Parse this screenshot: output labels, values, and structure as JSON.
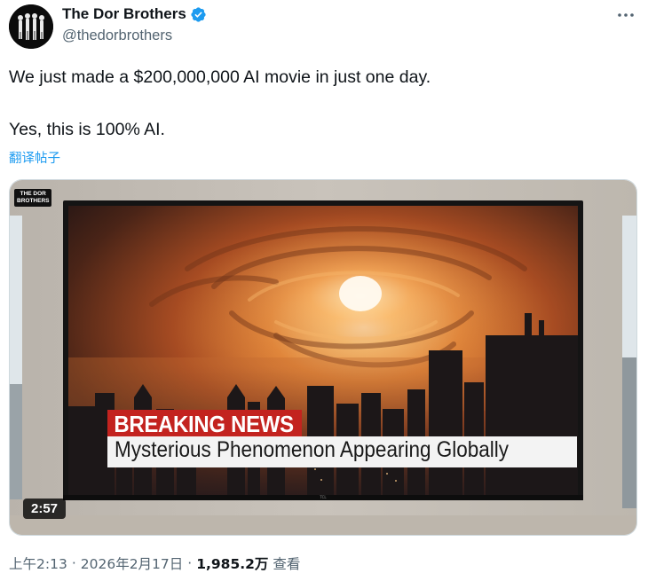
{
  "author": {
    "display_name": "The Dor Brothers",
    "handle": "@thedorbrothers",
    "verified_icon": "verified-badge-icon",
    "avatar_icon": "group-silhouette-avatar-icon"
  },
  "more_icon": "more-dots-icon",
  "tweet": {
    "line1": "We just made a $200,000,000 AI movie in just one day.",
    "line2": "Yes, this is 100% AI.",
    "translate_label": "翻译帖子"
  },
  "media": {
    "corner_logo_line1": "THE DOR",
    "corner_logo_line2": "BROTHERS",
    "breaking_label": "BREAKING NEWS",
    "headline": "Mysterious Phenomenon Appearing Globally",
    "tv_brand": "TCL",
    "duration": "2:57"
  },
  "meta": {
    "time": "上午2:13",
    "separator": "·",
    "date": "2026年2月17日",
    "views_count": "1,985.2万",
    "views_label": "查看"
  },
  "colors": {
    "accent": "#1d9bf0",
    "secondary_text": "#536471",
    "breaking_red": "#c3231f"
  }
}
